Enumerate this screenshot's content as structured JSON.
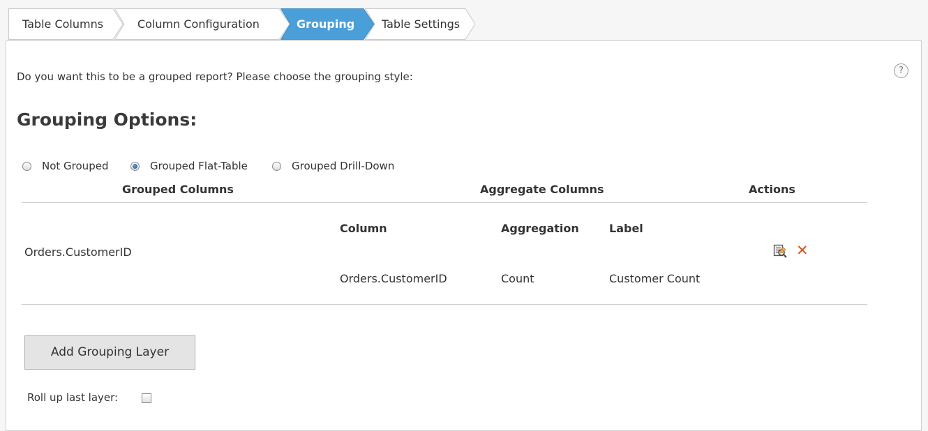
{
  "wizard": {
    "steps": [
      {
        "label": "Table Columns",
        "active": false
      },
      {
        "label": "Column Configuration",
        "active": false
      },
      {
        "label": "Grouping",
        "active": true
      },
      {
        "label": "Table Settings",
        "active": false
      }
    ],
    "active_color": "#4a9fd8"
  },
  "help": {
    "glyph": "?"
  },
  "intro_text": "Do you want this to be a grouped report? Please choose the grouping style:",
  "section_title": "Grouping Options:",
  "grouping_style": {
    "options": [
      "Not Grouped",
      "Grouped Flat-Table",
      "Grouped Drill-Down"
    ],
    "selected": "Grouped Flat-Table"
  },
  "table": {
    "headers": {
      "grouped": "Grouped Columns",
      "aggregate": "Aggregate Columns",
      "actions": "Actions"
    },
    "sub_headers": {
      "column": "Column",
      "aggregation": "Aggregation",
      "label": "Label"
    },
    "rows": [
      {
        "grouped_column": "Orders.CustomerID",
        "aggregates": [
          {
            "column": "Orders.CustomerID",
            "aggregation": "Count",
            "label": "Customer Count"
          }
        ],
        "actions": [
          "edit-icon",
          "delete-icon"
        ]
      }
    ]
  },
  "add_button_label": "Add Grouping Layer",
  "rollup": {
    "label": "Roll up last layer:",
    "checked": false
  },
  "colors": {
    "delete": "#d9541e",
    "panel_border": "#cfcfcf"
  }
}
